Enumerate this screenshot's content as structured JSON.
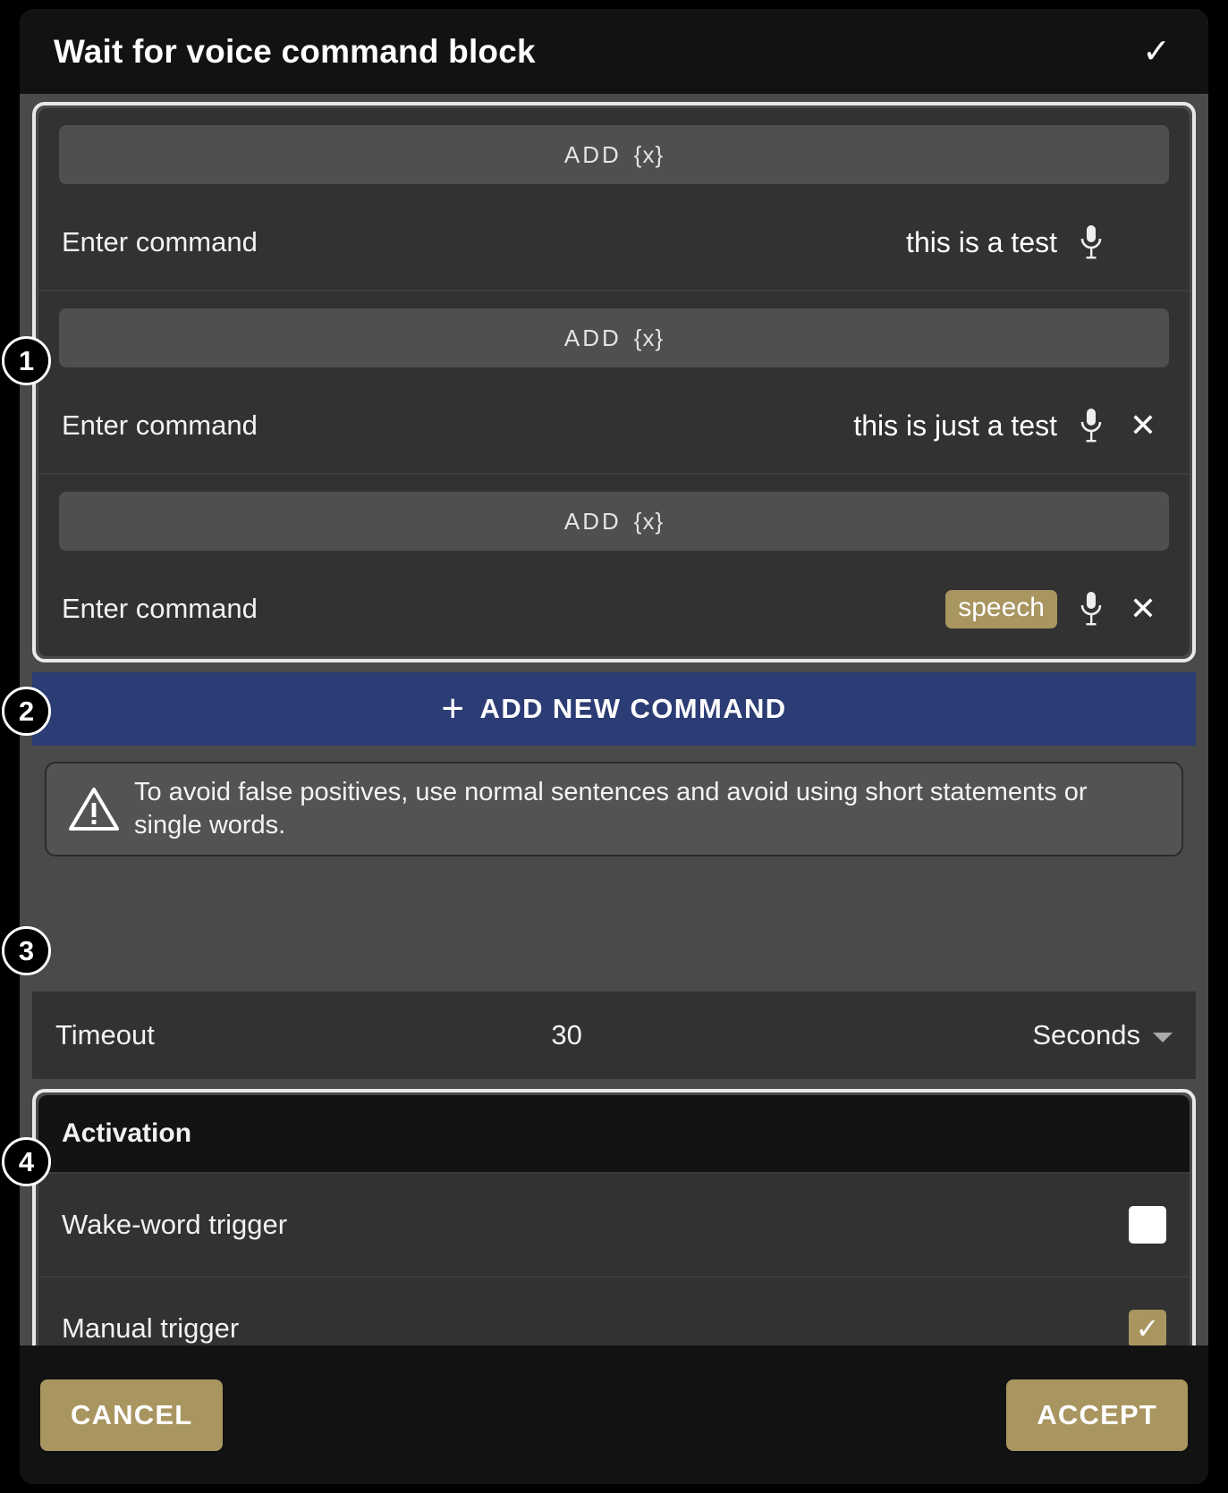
{
  "dialog": {
    "title": "Wait for voice command block",
    "confirm_icon": "check-icon",
    "confirm_glyph": "✓"
  },
  "commands": {
    "add_variable_label": "ADD",
    "add_variable_braces": "{x}",
    "items": [
      {
        "label": "Enter command",
        "value": "this is a test",
        "value_is_chip": false,
        "has_mic": true,
        "has_remove": false
      },
      {
        "label": "Enter command",
        "value": "this is just a test",
        "value_is_chip": false,
        "has_mic": true,
        "has_remove": true
      },
      {
        "label": "Enter command",
        "value": "speech",
        "value_is_chip": true,
        "has_mic": true,
        "has_remove": true
      }
    ]
  },
  "add_new_command": {
    "label": "ADD NEW COMMAND",
    "plus_glyph": "+"
  },
  "warning": {
    "icon": "warning-triangle-icon",
    "text": "To avoid false positives, use normal sentences and avoid using short statements or single words."
  },
  "timeout": {
    "label": "Timeout",
    "value": "30",
    "unit": "Seconds"
  },
  "activation": {
    "title": "Activation",
    "options": [
      {
        "label": "Wake-word trigger",
        "checked": false
      },
      {
        "label": "Manual trigger",
        "checked": true,
        "check_glyph": "✓"
      }
    ]
  },
  "footer": {
    "cancel_label": "CANCEL",
    "accept_label": "ACCEPT"
  },
  "callouts": [
    {
      "number": "1"
    },
    {
      "number": "2"
    },
    {
      "number": "3"
    },
    {
      "number": "4"
    }
  ],
  "colors": {
    "accent_gold": "#a89560",
    "primary_blue": "#2c3c74",
    "panel": "#323232",
    "dialog_bg": "#4a4a4a",
    "titlebar": "#121212"
  }
}
